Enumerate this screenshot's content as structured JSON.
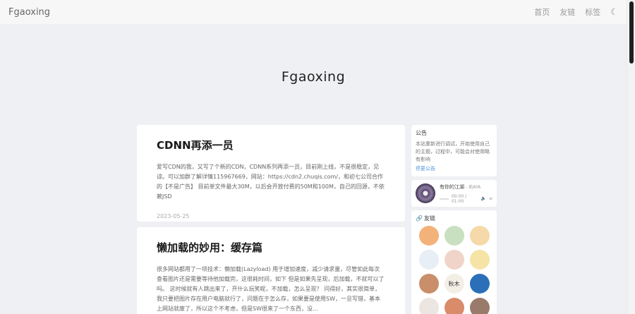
{
  "header": {
    "brand": "Fgaoxing",
    "nav": [
      "首页",
      "友链",
      "标签"
    ],
    "theme_icon": "moon-icon"
  },
  "hero": {
    "title": "Fgaoxing"
  },
  "posts": [
    {
      "title": "CDNN再添一员",
      "excerpt": "爱写CDN的我，又写了个新的CDN，CDNN系列再添一员，目前刚上线，不是很稳定，见谅。可以加群了解详情115967669，网站：https://cdn2.chuqis.com/，和初七公司合作的【不是广告】 目前单文件最大30M，以后会开放付费的50M和100M，自己的回源，不依赖JSD",
      "date": "2023-05-25"
    },
    {
      "title": "懒加载的妙用：缓存篇",
      "excerpt": "很多网站都用了一项技术：懒加载(Lazyload) 用于增加速度，减少请求量，尽管如此每次查看图片还是需要等待他加载完，这很耗时间，如下 但是如果先呈现，后加载，不就可以了吗。 这时候就有人跳出来了，开什么玩笑呢，不加载，怎么呈现？ 问得好，其实很简单，我只要把图片存在用户电脑就行了，问题在于怎么存，如果要是使用SW，一旦写错，基本上网站就废了，所以这个不考虑，但是SW很来了一个东西，没..."
    }
  ],
  "notice": {
    "title": "公告",
    "text": "本站重新进行调试，开始使用自己的主题，过程中，可能会对使用略有影响",
    "link": "停更公告"
  },
  "music": {
    "song": "有你的江湖",
    "artist": "- 凯AYA",
    "time": "00:00 / 01:00"
  },
  "friends": {
    "title": "友链",
    "avatar_label": "秋木",
    "colors": [
      "#f2b27a",
      "#c9e0c0",
      "#f5d9a8",
      "#e8eef5",
      "#f0d4c8",
      "#f6e3a6",
      "#c98f6a",
      "#f4efe6",
      "#2a6fb8",
      "#ece6e2",
      "#d98b6a",
      "#9a7a6a"
    ]
  }
}
